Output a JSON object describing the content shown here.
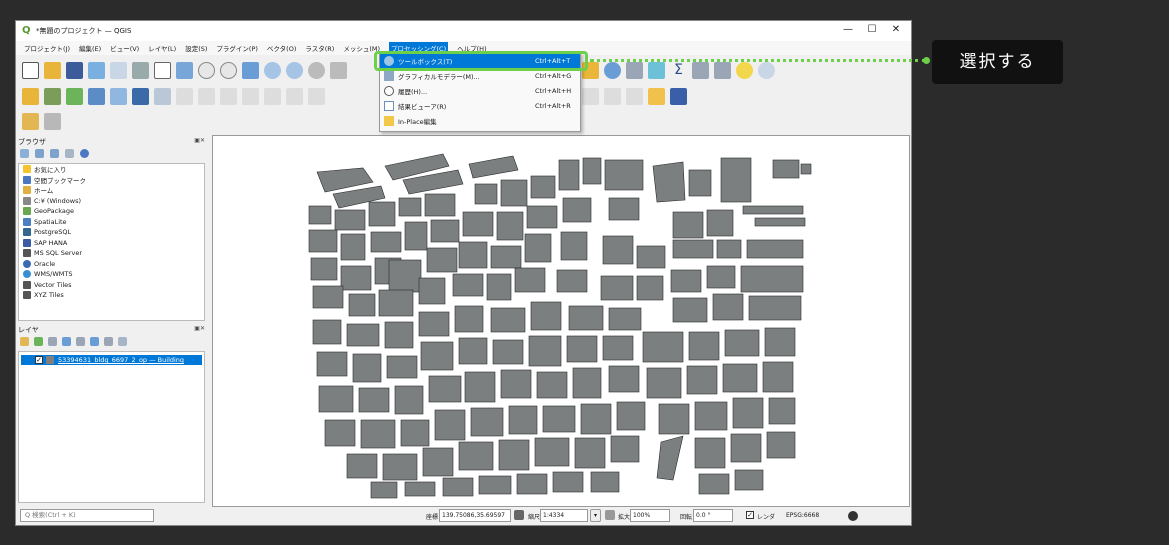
{
  "window": {
    "title": "*無題のプロジェクト — QGIS",
    "minimize": "—",
    "maximize": "☐",
    "close": "✕"
  },
  "menubar": {
    "items": [
      "プロジェクト(J)",
      "編集(E)",
      "ビュー(V)",
      "レイヤ(L)",
      "設定(S)",
      "プラグイン(P)",
      "ベクタ(O)",
      "ラスタ(R)",
      "メッシュ(M)",
      "プロセッシング(C)",
      "ヘルプ(H)"
    ],
    "active_index": 9
  },
  "processing_menu": {
    "items": [
      {
        "label": "ツールボックス(T)",
        "shortcut": "Ctrl+Alt+T",
        "icon": "gear-icon",
        "selected": true
      },
      {
        "label": "グラフィカルモデラー(M)...",
        "shortcut": "Ctrl+Alt+G",
        "icon": "model-icon",
        "selected": false
      },
      {
        "label": "履歴(H)...",
        "shortcut": "Ctrl+Alt+H",
        "icon": "history-icon",
        "selected": false
      },
      {
        "label": "結果ビューア(R)",
        "shortcut": "Ctrl+Alt+R",
        "icon": "results-icon",
        "selected": false
      },
      {
        "label": "In-Place編集",
        "shortcut": "",
        "icon": "edit-inplace-icon",
        "selected": false
      }
    ]
  },
  "browser_panel": {
    "title": "ブラウザ",
    "items": [
      {
        "label": "お気に入り",
        "icon": "star-icon",
        "color": "#f4c430"
      },
      {
        "label": "空間ブックマーク",
        "icon": "bookmark-icon",
        "color": "#4a78c2"
      },
      {
        "label": "ホーム",
        "icon": "home-folder-icon",
        "color": "#e0b040"
      },
      {
        "label": "C:¥ (Windows)",
        "icon": "drive-icon",
        "color": "#888888"
      },
      {
        "label": "GeoPackage",
        "icon": "geopackage-icon",
        "color": "#6aa84f"
      },
      {
        "label": "SpatiaLite",
        "icon": "spatialite-icon",
        "color": "#4d7ebf"
      },
      {
        "label": "PostgreSQL",
        "icon": "postgresql-icon",
        "color": "#336791"
      },
      {
        "label": "SAP HANA",
        "icon": "saphana-icon",
        "color": "#3b5ba5"
      },
      {
        "label": "MS SQL Server",
        "icon": "mssql-icon",
        "color": "#555555"
      },
      {
        "label": "Oracle",
        "icon": "oracle-icon",
        "color": "#3c6bb4"
      },
      {
        "label": "WMS/WMTS",
        "icon": "wms-icon",
        "color": "#3a8fd1"
      },
      {
        "label": "Vector Tiles",
        "icon": "vectortiles-icon",
        "color": "#555555"
      },
      {
        "label": "XYZ Tiles",
        "icon": "xyztiles-icon",
        "color": "#555555"
      }
    ]
  },
  "layers_panel": {
    "title": "レイヤ",
    "layers": [
      {
        "label": "53394631_bldg_6697_2_op — Building",
        "checked": true,
        "selected": true
      }
    ]
  },
  "statusbar": {
    "search_placeholder": "Q 検索(Ctrl + K)",
    "coord_label": "座標",
    "coord_value": "139.75086,35.69597",
    "scale_label": "縮尺",
    "scale_value": "1:4334",
    "magnify_label": "拡大",
    "magnify_value": "100%",
    "rotation_label": "回転",
    "rotation_value": "0.0 °",
    "render_label": "レンダ",
    "crs_label": "EPSG:6668"
  },
  "annotation": {
    "callout_text": "選択する",
    "highlight_color": "#6cd04a"
  }
}
